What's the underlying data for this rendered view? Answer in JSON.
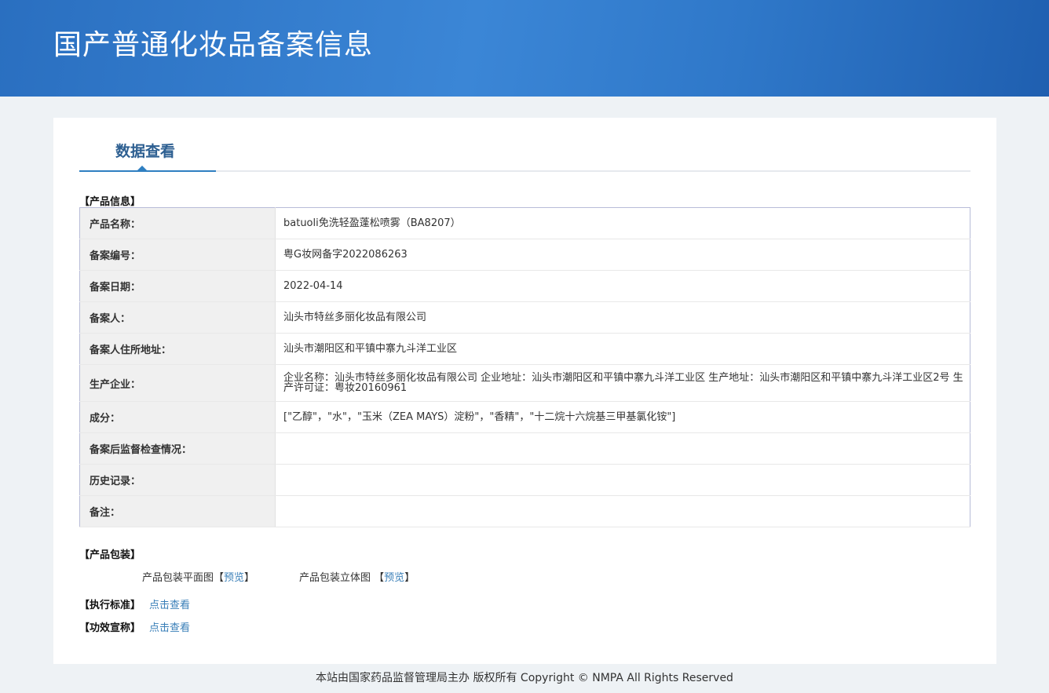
{
  "header": {
    "title": "国产普通化妆品备案信息"
  },
  "tab": {
    "label": "数据查看"
  },
  "product_info": {
    "section_title": "【产品信息】",
    "rows": [
      {
        "label": "产品名称：",
        "value": "batuoli免洗轻盈蓬松喷雾（BA8207）"
      },
      {
        "label": "备案编号：",
        "value": "粤G妆网备字2022086263"
      },
      {
        "label": "备案日期：",
        "value": "2022-04-14"
      },
      {
        "label": "备案人：",
        "value": "汕头市特丝多丽化妆品有限公司"
      },
      {
        "label": "备案人住所地址：",
        "value": "汕头市潮阳区和平镇中寨九斗洋工业区"
      },
      {
        "label": "生产企业：",
        "value": "企业名称：汕头市特丝多丽化妆品有限公司 企业地址：汕头市潮阳区和平镇中寨九斗洋工业区 生产地址：汕头市潮阳区和平镇中寨九斗洋工业区2号 生产许可证：粤妆20160961"
      },
      {
        "label": "成分：",
        "value": "[\"乙醇\"，\"水\"，\"玉米（ZEA MAYS）淀粉\"，\"香精\"，\"十二烷十六烷基三甲基氯化铵\"]"
      },
      {
        "label": "备案后监督检查情况：",
        "value": ""
      },
      {
        "label": "历史记录：",
        "value": ""
      },
      {
        "label": "备注：",
        "value": ""
      }
    ]
  },
  "packaging": {
    "section_title": "【产品包装】",
    "flat_label": "产品包装平面图",
    "solid_label": "产品包装立体图",
    "lb": "【",
    "rb": "】",
    "preview": "预览"
  },
  "standard": {
    "label": "【执行标准】",
    "link": "点击查看"
  },
  "efficacy": {
    "label": "【功效宣称】",
    "link": "点击查看"
  },
  "footer": {
    "text": "本站由国家药品监督管理局主办 版权所有 Copyright © NMPA All Rights Reserved"
  }
}
